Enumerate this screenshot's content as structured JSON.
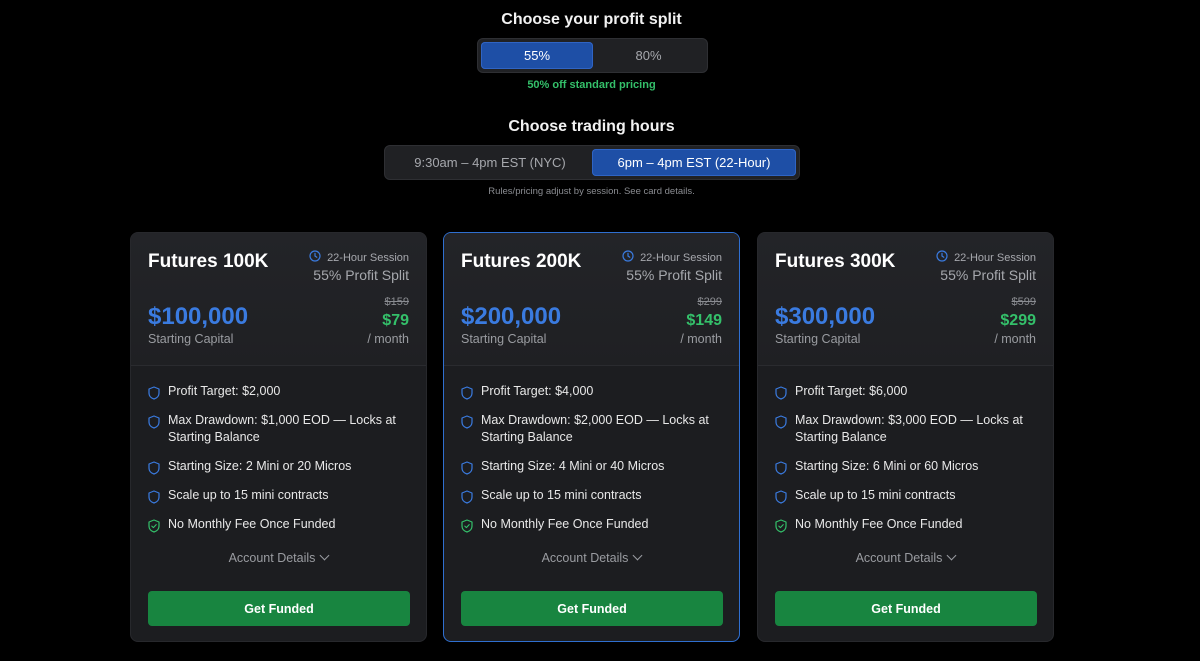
{
  "profit_split": {
    "title": "Choose your profit split",
    "options": [
      "55%",
      "80%"
    ],
    "selected_index": 0,
    "discount_note": "50% off standard pricing"
  },
  "trading_hours": {
    "title": "Choose trading hours",
    "options": [
      "9:30am – 4pm EST (NYC)",
      "6pm – 4pm EST (22-Hour)"
    ],
    "selected_index": 1,
    "note": "Rules/pricing adjust by session. See card details."
  },
  "colors": {
    "accent_blue": "#3a7be0",
    "selected_blue": "#1e4fa6",
    "price_green": "#34c06a",
    "button_green": "#188540"
  },
  "cards": [
    {
      "title": "Futures 100K",
      "session": "22-Hour Session",
      "split": "55% Profit Split",
      "capital": "$100,000",
      "capital_label": "Starting Capital",
      "old_price": "$159",
      "new_price": "$79",
      "per": "/ month",
      "features": [
        {
          "icon": "shield-icon",
          "text": "Profit Target: $2,000"
        },
        {
          "icon": "shield-icon",
          "text": "Max Drawdown: $1,000 EOD — Locks at Starting Balance"
        },
        {
          "icon": "shield-icon",
          "text": "Starting Size: 2 Mini or 20 Micros"
        },
        {
          "icon": "shield-icon",
          "text": "Scale up to 15 mini contracts"
        },
        {
          "icon": "shield-check-icon",
          "text": "No Monthly Fee Once Funded"
        }
      ],
      "details_label": "Account Details",
      "cta": "Get Funded",
      "featured": false
    },
    {
      "title": "Futures 200K",
      "session": "22-Hour Session",
      "split": "55% Profit Split",
      "capital": "$200,000",
      "capital_label": "Starting Capital",
      "old_price": "$299",
      "new_price": "$149",
      "per": "/ month",
      "features": [
        {
          "icon": "shield-icon",
          "text": "Profit Target: $4,000"
        },
        {
          "icon": "shield-icon",
          "text": "Max Drawdown: $2,000 EOD — Locks at Starting Balance"
        },
        {
          "icon": "shield-icon",
          "text": "Starting Size: 4 Mini or 40 Micros"
        },
        {
          "icon": "shield-icon",
          "text": "Scale up to 15 mini contracts"
        },
        {
          "icon": "shield-check-icon",
          "text": "No Monthly Fee Once Funded"
        }
      ],
      "details_label": "Account Details",
      "cta": "Get Funded",
      "featured": true
    },
    {
      "title": "Futures 300K",
      "session": "22-Hour Session",
      "split": "55% Profit Split",
      "capital": "$300,000",
      "capital_label": "Starting Capital",
      "old_price": "$599",
      "new_price": "$299",
      "per": "/ month",
      "features": [
        {
          "icon": "shield-icon",
          "text": "Profit Target: $6,000"
        },
        {
          "icon": "shield-icon",
          "text": "Max Drawdown: $3,000 EOD — Locks at Starting Balance"
        },
        {
          "icon": "shield-icon",
          "text": "Starting Size: 6 Mini or 60 Micros"
        },
        {
          "icon": "shield-icon",
          "text": "Scale up to 15 mini contracts"
        },
        {
          "icon": "shield-check-icon",
          "text": "No Monthly Fee Once Funded"
        }
      ],
      "details_label": "Account Details",
      "cta": "Get Funded",
      "featured": false
    }
  ]
}
